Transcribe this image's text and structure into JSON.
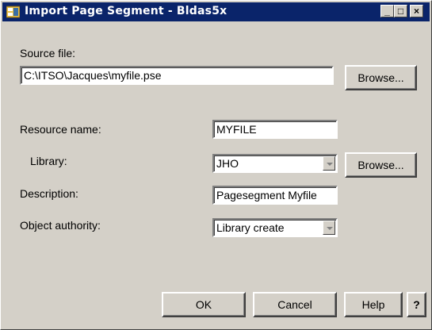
{
  "window": {
    "title": "Import Page Segment - Bldas5x",
    "minimize_glyph": "_",
    "maximize_glyph": "□",
    "close_glyph": "×"
  },
  "source": {
    "label": "Source file:",
    "value": "C:\\ITSO\\Jacques\\myfile.pse",
    "browse_label": "Browse..."
  },
  "resource": {
    "label": "Resource name:",
    "value": "MYFILE"
  },
  "library": {
    "label": "Library:",
    "value": "JHO",
    "browse_label": "Browse..."
  },
  "description": {
    "label": "Description:",
    "value": "Pagesegment Myfile"
  },
  "authority": {
    "label": "Object authority:",
    "value": "Library create"
  },
  "buttons": {
    "ok": "OK",
    "cancel": "Cancel",
    "help": "Help",
    "whats_this": "?"
  }
}
